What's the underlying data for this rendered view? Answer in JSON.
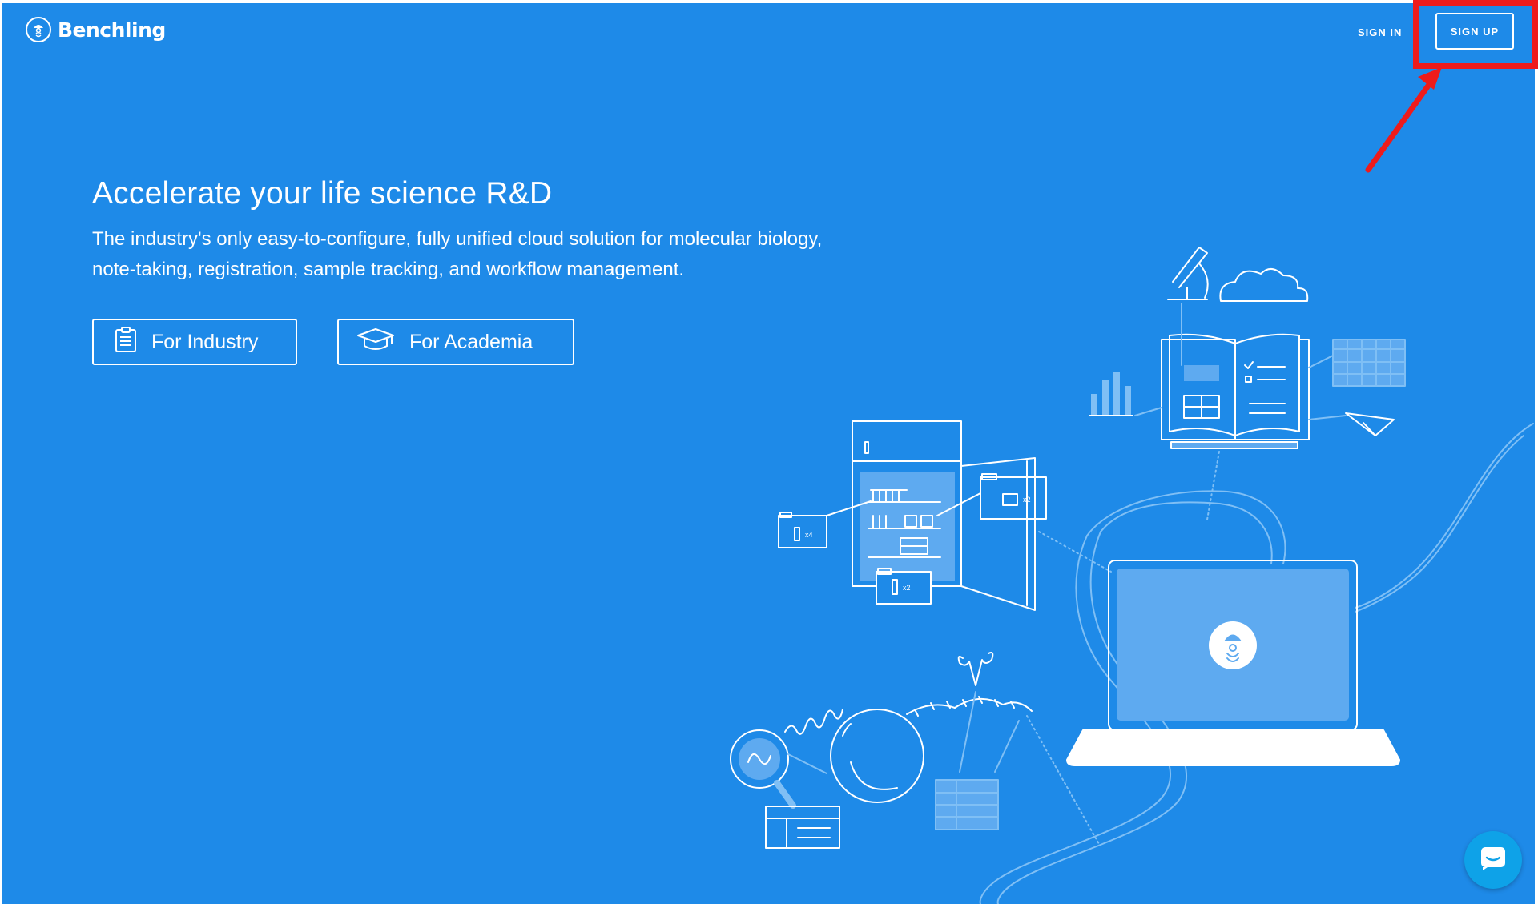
{
  "brand": {
    "name": "Benchling"
  },
  "nav": {
    "sign_in": "SIGN IN",
    "sign_up": "SIGN UP"
  },
  "hero": {
    "title": "Accelerate your life science R&D",
    "subtitle_line1": "The industry's only easy-to-configure, fully unified cloud solution for molecular biology,",
    "subtitle_line2": "note-taking, registration, sample tracking, and workflow management.",
    "cta_industry": "For Industry",
    "cta_academia": "For Academia"
  },
  "illustration": {
    "freezer_labels": [
      "x4",
      "x2",
      "x2"
    ]
  },
  "colors": {
    "background": "#1e8ae8",
    "accent_light": "#5eaaf0",
    "chat_button": "#0ea2e8",
    "annotation": "#ee1b1b"
  },
  "icons": [
    "benchling-logo-icon",
    "clipboard-icon",
    "graduation-cap-icon",
    "chat-icon"
  ]
}
